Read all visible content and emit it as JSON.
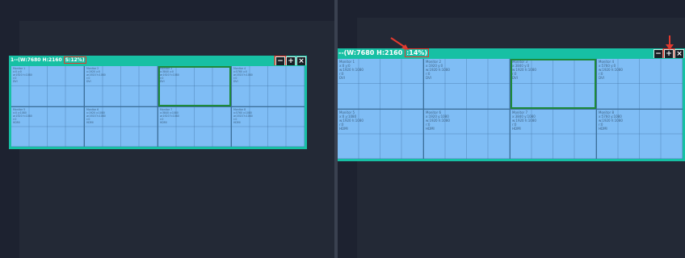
{
  "left_view": {
    "screen": {
      "title": "1--(W:7680 H:2160 ",
      "zoom": "S:12%)",
      "buttons": {
        "minimize": "−",
        "maximize": "+",
        "close": "×"
      }
    }
  },
  "right_view": {
    "screen": {
      "title": "--(W:7680 H:2160 ",
      "zoom": ":14%)",
      "buttons": {
        "minimize": "−",
        "maximize": "+",
        "close": "×"
      }
    }
  },
  "monitors": [
    {
      "name": "Monitor 1",
      "pos": "x:0  y:0",
      "size": "w:1920  h:1080",
      "layer": "r:0",
      "input": "DVI"
    },
    {
      "name": "Monitor 2",
      "pos": "x:1920  y:0",
      "size": "w:1920  h:1080",
      "layer": "r:0",
      "input": "DVI"
    },
    {
      "name": "Monitor 3",
      "pos": "x:3840  y:0",
      "size": "w:1920  h:1080",
      "layer": "r:0",
      "input": "DVI"
    },
    {
      "name": "Monitor 4",
      "pos": "x:5760  y:0",
      "size": "w:1920  h:1080",
      "layer": "r:0",
      "input": "DVI"
    },
    {
      "name": "Monitor 5",
      "pos": "x:0  y:1080",
      "size": "w:1920  h:1080",
      "layer": "r:0",
      "input": "HDMI"
    },
    {
      "name": "Monitor 6",
      "pos": "x:1920  y:1080",
      "size": "w:1920  h:1080",
      "layer": "r:0",
      "input": "HDMI"
    },
    {
      "name": "Monitor 7",
      "pos": "x:3840  y:1080",
      "size": "w:1920  h:1080",
      "layer": "r:0",
      "input": "HDMI"
    },
    {
      "name": "Monitor 8",
      "pos": "x:5760  y:1080",
      "size": "w:1920  h:1080",
      "layer": "r:0",
      "input": "HDMI"
    }
  ],
  "selected_monitor": "Monitor 3",
  "colors": {
    "background": "#1d2230",
    "screen_frame": "#17c0a4",
    "monitor_fill": "#7fbdf5",
    "selection": "#1e8a3a",
    "annotation": "#e23a2e"
  }
}
